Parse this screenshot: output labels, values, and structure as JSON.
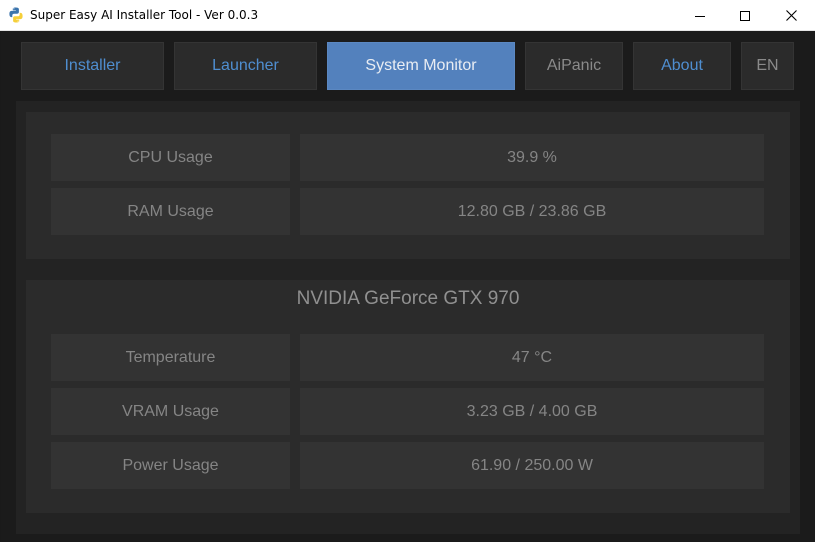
{
  "window": {
    "title": "Super Easy AI Installer Tool - Ver 0.0.3"
  },
  "tabs": [
    {
      "label": "Installer"
    },
    {
      "label": "Launcher"
    },
    {
      "label": "System Monitor"
    },
    {
      "label": "AiPanic"
    },
    {
      "label": "About"
    },
    {
      "label": "EN"
    }
  ],
  "system": {
    "rows": [
      {
        "label": "CPU Usage",
        "value": "39.9 %"
      },
      {
        "label": "RAM Usage",
        "value": "12.80 GB / 23.86 GB"
      }
    ]
  },
  "gpu": {
    "name": "NVIDIA GeForce GTX 970",
    "rows": [
      {
        "label": "Temperature",
        "value": "47 °C"
      },
      {
        "label": "VRAM Usage",
        "value": "3.23 GB / 4.00 GB"
      },
      {
        "label": "Power Usage",
        "value": "61.90 / 250.00  W"
      }
    ]
  },
  "colors": {
    "accent": "#5381bd",
    "tab_text": "#4f8ed0",
    "background": "#1b1b1b"
  }
}
